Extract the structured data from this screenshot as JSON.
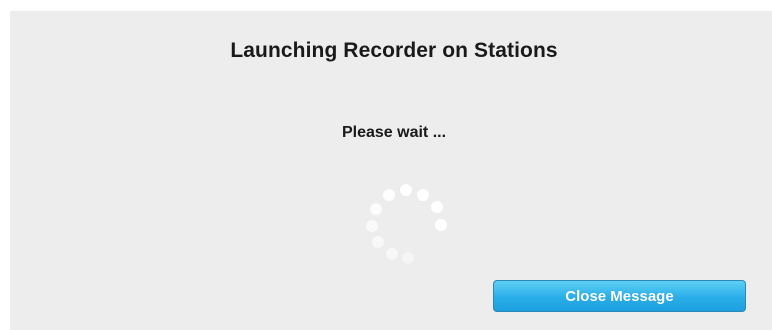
{
  "dialog": {
    "title": "Launching Recorder on Stations",
    "message": "Please wait ...",
    "close_label": "Close Message"
  },
  "colors": {
    "background": "#ededed",
    "button_top": "#5ed0f5",
    "button_bottom": "#1ba0df",
    "button_text": "#ffffff",
    "spinner_dot": "#ffffff"
  },
  "icons": {
    "spinner": "loading-spinner-icon"
  }
}
